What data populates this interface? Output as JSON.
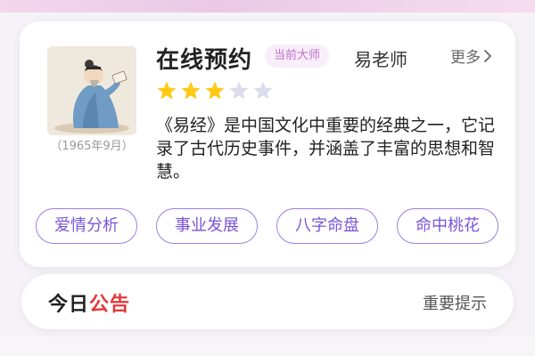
{
  "colors": {
    "accent_purple": "#7a55d8",
    "badge_pink": "#c26fd0",
    "star_filled": "#ffc915",
    "star_empty": "#dcdcec",
    "notice_red": "#e23a3a"
  },
  "card": {
    "title": "在线预约",
    "badge": "当前大师",
    "master_name": "易老师",
    "more_label": "更多",
    "more_icon": "chevron-right-icon",
    "rating": {
      "filled": 3,
      "total": 5
    },
    "portrait_caption": "（1965年9月）",
    "description": "《易经》是中国文化中重要的经典之一，它记录了古代历史事件，并涵盖了丰富的思想和智慧。",
    "tags": [
      "爱情分析",
      "事业发展",
      "八字命盘",
      "命中桃花"
    ]
  },
  "notice": {
    "label_part1": "今日",
    "label_part2": "公告",
    "text": "重要提示"
  }
}
